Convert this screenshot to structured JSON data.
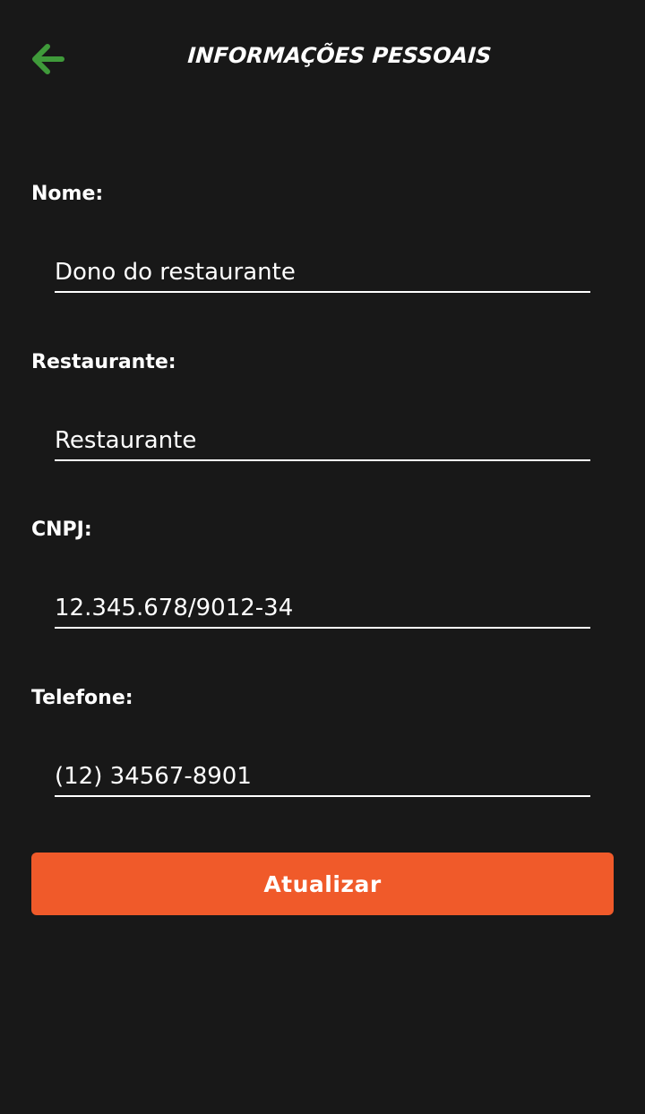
{
  "header": {
    "title": "INFORMAÇÕES PESSOAIS",
    "back_icon": "arrow-left-icon",
    "back_icon_color": "#3f9a3a"
  },
  "form": {
    "fields": [
      {
        "label": "Nome:",
        "value": "Dono do restaurante"
      },
      {
        "label": "Restaurante:",
        "value": "Restaurante"
      },
      {
        "label": "CNPJ:",
        "value": "12.345.678/9012-34"
      },
      {
        "label": "Telefone:",
        "value": "(12) 34567-8901"
      }
    ],
    "submit_label": "Atualizar",
    "submit_color": "#f05a2a"
  },
  "theme": {
    "background": "#181818",
    "text": "#ffffff"
  }
}
